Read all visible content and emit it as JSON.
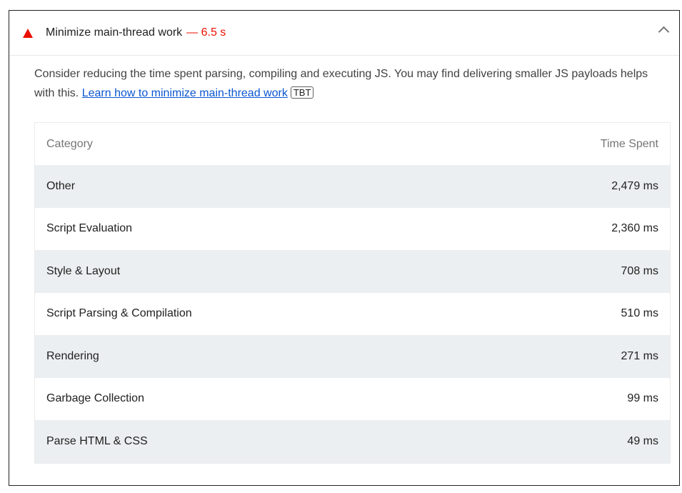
{
  "audit": {
    "title": "Minimize main-thread work",
    "value": "— 6.5 s",
    "status_color": "#eb0f00",
    "status_icon": "fail-triangle-icon",
    "toggle_icon": "chevron-up-icon",
    "description_text": "Consider reducing the time spent parsing, compiling and executing JS. You may find delivering smaller JS payloads helps with this.",
    "learn_more_link": "Learn how to minimize main-thread work",
    "badge": "TBT"
  },
  "table": {
    "headers": [
      "Category",
      "Time Spent"
    ],
    "rows": [
      {
        "category": "Other",
        "time": "2,479 ms"
      },
      {
        "category": "Script Evaluation",
        "time": "2,360 ms"
      },
      {
        "category": "Style & Layout",
        "time": "708 ms"
      },
      {
        "category": "Script Parsing & Compilation",
        "time": "510 ms"
      },
      {
        "category": "Rendering",
        "time": "271 ms"
      },
      {
        "category": "Garbage Collection",
        "time": "99 ms"
      },
      {
        "category": "Parse HTML & CSS",
        "time": "49 ms"
      }
    ]
  }
}
